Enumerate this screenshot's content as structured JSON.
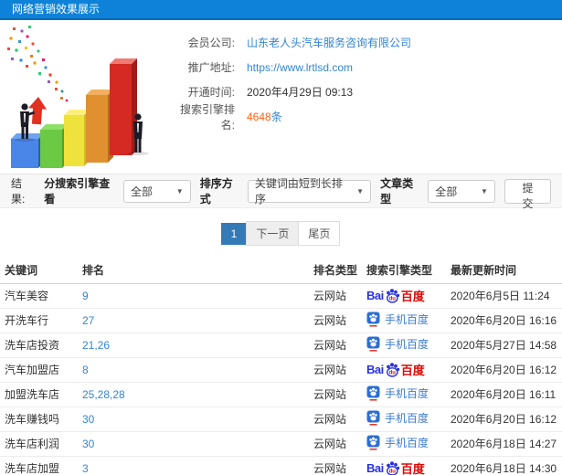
{
  "header": {
    "title": "网络营销效果展示"
  },
  "info": {
    "rows": [
      {
        "label": "会员公司:",
        "value": "山东老人头汽车服务咨询有限公司",
        "type": "link"
      },
      {
        "label": "推广地址:",
        "value": "https://www.lrtlsd.com",
        "type": "link"
      },
      {
        "label": "开通时间:",
        "value": "2020年4月29日 09:13",
        "type": "text"
      },
      {
        "label": "搜索引擎排名:",
        "value": "4648",
        "suffix": "条",
        "type": "highlight"
      }
    ]
  },
  "filters": {
    "result_label": "结果:",
    "engine_filter_label": "分搜索引擎查看",
    "engine_filter_value": "全部",
    "sort_label": "排序方式",
    "sort_value": "关键词由短到长排序",
    "article_type_label": "文章类型",
    "article_type_value": "全部",
    "submit_label": "提交",
    "caret_glyph": "▼"
  },
  "pagination": {
    "current": "1",
    "next": "下一页",
    "last": "尾页"
  },
  "table": {
    "headers": [
      "关键词",
      "排名",
      "排名类型",
      "搜索引擎类型",
      "最新更新时间"
    ],
    "rows": [
      {
        "keyword": "汽车美容",
        "rank": "9",
        "rank_type": "云网站",
        "engine": "baidu-pc",
        "updated": "2020年6月5日 11:24"
      },
      {
        "keyword": "开洗车行",
        "rank": "27",
        "rank_type": "云网站",
        "engine": "baidu-mobile",
        "updated": "2020年6月20日 16:16"
      },
      {
        "keyword": "洗车店投资",
        "rank": "21,26",
        "rank_type": "云网站",
        "engine": "baidu-mobile",
        "updated": "2020年5月27日 14:58"
      },
      {
        "keyword": "汽车加盟店",
        "rank": "8",
        "rank_type": "云网站",
        "engine": "baidu-pc",
        "updated": "2020年6月20日 16:12"
      },
      {
        "keyword": "加盟洗车店",
        "rank": "25,28,28",
        "rank_type": "云网站",
        "engine": "baidu-mobile",
        "updated": "2020年6月20日 16:11"
      },
      {
        "keyword": "洗车赚钱吗",
        "rank": "30",
        "rank_type": "云网站",
        "engine": "baidu-mobile",
        "updated": "2020年6月20日 16:12"
      },
      {
        "keyword": "洗车店利润",
        "rank": "30",
        "rank_type": "云网站",
        "engine": "baidu-mobile",
        "updated": "2020年6月18日 14:27"
      },
      {
        "keyword": "洗车店加盟",
        "rank": "3",
        "rank_type": "云网站",
        "engine": "baidu-pc",
        "updated": "2020年6月18日 14:30"
      }
    ]
  },
  "engines": {
    "baidu_pc": {
      "bai": "Bai",
      "du": "du",
      "cn": "百度"
    },
    "baidu_mobile": {
      "label": "手机百度"
    }
  },
  "colors": {
    "header_blue": "#0d82d8",
    "link_blue": "#3385d6",
    "highlight_orange": "#ff6213",
    "pagination_active": "#337ab7",
    "baidu_blue": "#2932e1",
    "baidu_red": "#e10602",
    "filter_bg": "#f7f7f7"
  }
}
